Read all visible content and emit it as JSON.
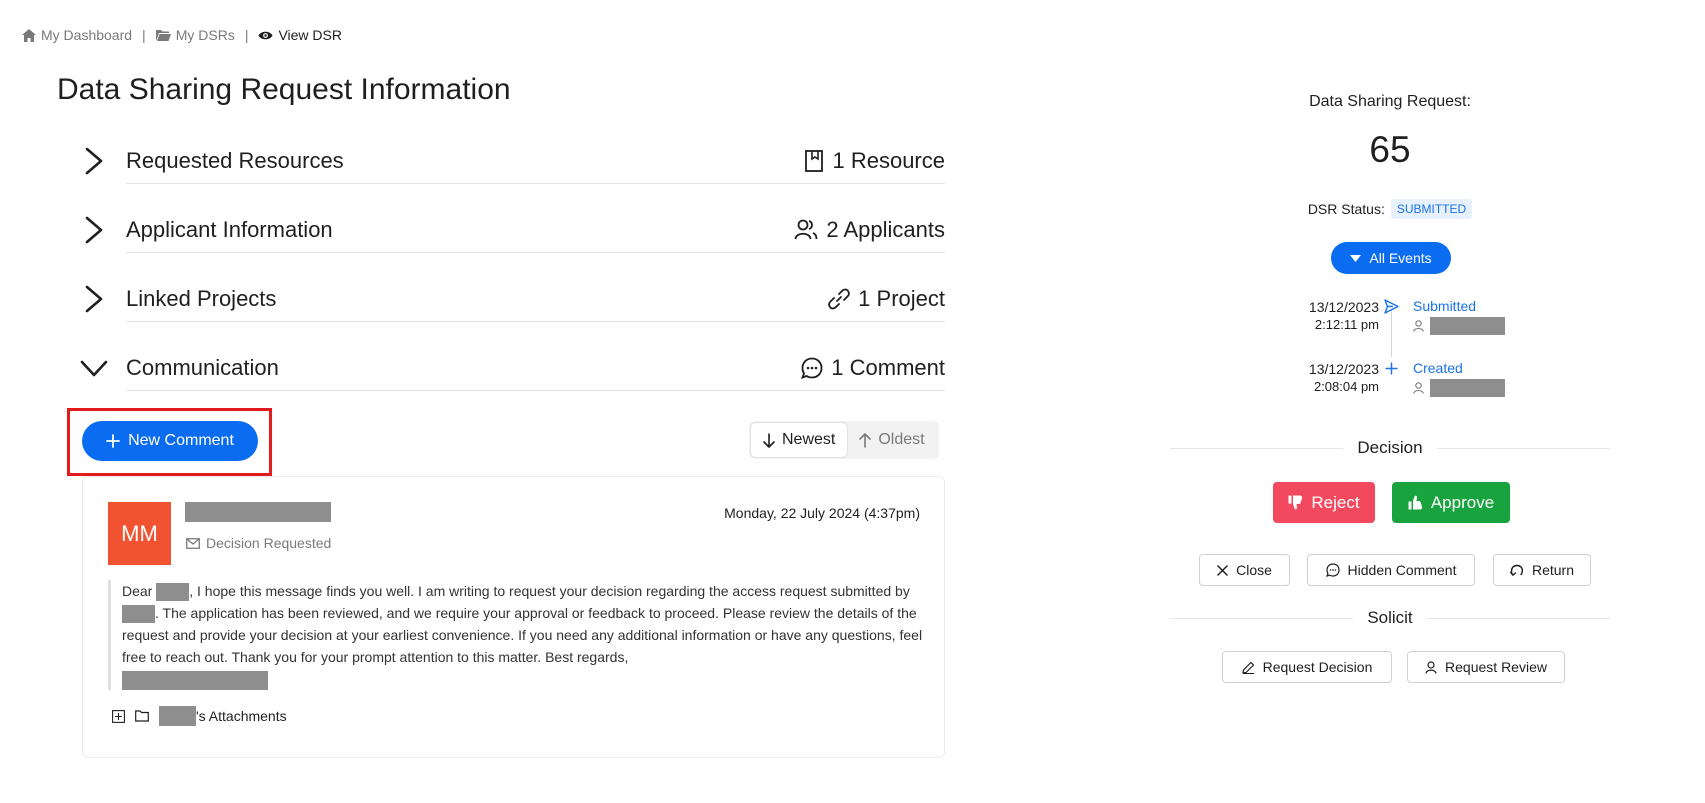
{
  "breadcrumb": {
    "dashboard": "My Dashboard",
    "dsrs": "My DSRs",
    "current": "View DSR",
    "separator": "|"
  },
  "page": {
    "title": "Data Sharing Request Information"
  },
  "sections": [
    {
      "label": "Requested Resources",
      "meta": "1 Resource",
      "icon": "bookmark-icon",
      "expanded": false
    },
    {
      "label": "Applicant Information",
      "meta": "2 Applicants",
      "icon": "users-icon",
      "expanded": false
    },
    {
      "label": "Linked Projects",
      "meta": "1 Project",
      "icon": "link-icon",
      "expanded": false
    },
    {
      "label": "Communication",
      "meta": "1 Comment",
      "icon": "comment-icon",
      "expanded": true
    }
  ],
  "communication": {
    "new_comment_label": "New Comment",
    "sort_newest": "Newest",
    "sort_oldest": "Oldest",
    "comment": {
      "initials": "MM",
      "date": "Monday, 22 July 2024 (4:37pm)",
      "tag": "Decision Requested",
      "body_1": "Dear ",
      "body_2": ", I hope this message finds you well. I am writing to request your decision regarding the access request submitted by",
      "body_3": ". The application has been reviewed, and we require your approval or feedback to proceed. Please review the details of the request and provide your decision at your earliest convenience. If you need any additional information or have any questions, feel free to reach out. Thank you for your prompt attention to this matter. Best regards,",
      "attachments_suffix": "'s Attachments"
    }
  },
  "sidebar": {
    "request_label": "Data Sharing Request:",
    "request_number": "65",
    "status_label": "DSR Status:",
    "status_value": "SUBMITTED",
    "events_button": "All Events",
    "events": [
      {
        "date": "13/12/2023",
        "time": "2:12:11 pm",
        "label": "Submitted",
        "icon": "send-icon"
      },
      {
        "date": "13/12/2023",
        "time": "2:08:04 pm",
        "label": "Created",
        "icon": "plus-icon"
      }
    ],
    "decision_heading": "Decision",
    "reject_label": "Reject",
    "approve_label": "Approve",
    "close_label": "Close",
    "hidden_comment_label": "Hidden Comment",
    "return_label": "Return",
    "solicit_heading": "Solicit",
    "request_decision_label": "Request Decision",
    "request_review_label": "Request Review"
  },
  "colors": {
    "primary": "#0a6cf0",
    "reject": "#f2495f",
    "approve": "#18a33e",
    "avatar": "#f1522f",
    "highlight": "#e21c1c",
    "status_badge_bg": "#e6f1fd",
    "status_badge_text": "#1a73e8"
  }
}
